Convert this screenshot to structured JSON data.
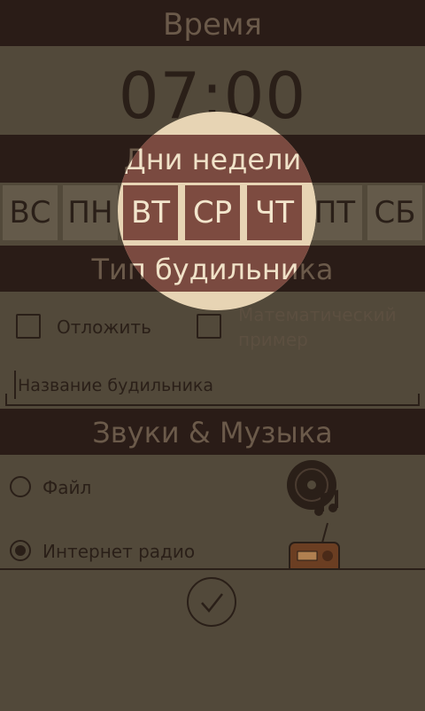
{
  "time_section": {
    "title": "Время",
    "time": "07:00"
  },
  "days_section": {
    "title": "Дни недели",
    "days": [
      {
        "label": "ВС",
        "selected": false
      },
      {
        "label": "ПН",
        "selected": false
      },
      {
        "label": "ВТ",
        "selected": true
      },
      {
        "label": "СР",
        "selected": true
      },
      {
        "label": "ЧТ",
        "selected": true
      },
      {
        "label": "ПТ",
        "selected": false
      },
      {
        "label": "СБ",
        "selected": false
      }
    ]
  },
  "type_section": {
    "title": "Тип будильника",
    "snooze_label": "Отложить",
    "math_label_line1": "Математический",
    "math_label_line2": "пример",
    "name_placeholder": "Название будильника"
  },
  "sound_section": {
    "title": "Звуки & Музыка",
    "file_label": "Файл",
    "radio_label": "Интернет радио",
    "selected": "radio"
  },
  "icons": {
    "file": "music-disc-icon",
    "radio": "retro-radio-icon",
    "confirm": "check-icon"
  },
  "colors": {
    "background": "#52493a",
    "band": "#2a1c17",
    "highlight": "#e7d4b4",
    "selected_day": "#7d4b40"
  }
}
